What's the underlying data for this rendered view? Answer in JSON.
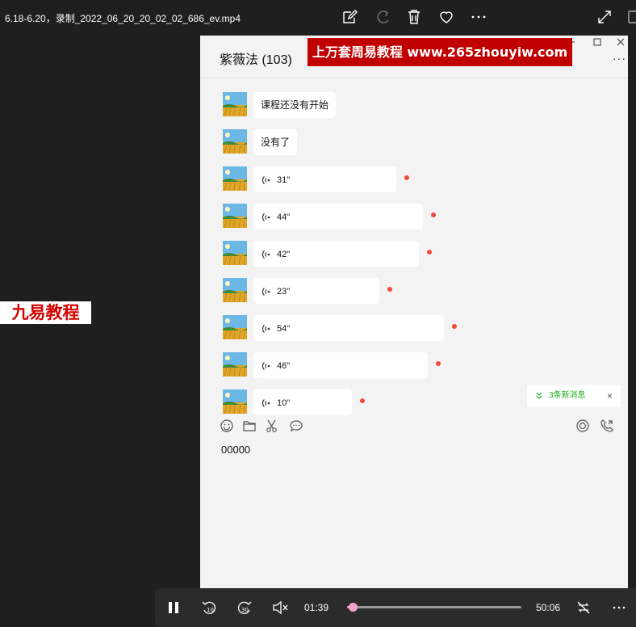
{
  "window": {
    "title": "6.18-6.20，录制_2022_06_20_20_02_02_686_ev.mp4"
  },
  "chat": {
    "title": "紫薇法 (103)",
    "banner": "上万套周易教程 www.265zhouyiw.com",
    "more": "···",
    "messages": [
      {
        "type": "text",
        "text": "课程还没有开始",
        "unread": false
      },
      {
        "type": "text",
        "text": "没有了",
        "unread": false
      },
      {
        "type": "voice",
        "text": "31\"",
        "seconds": 31,
        "unread": true
      },
      {
        "type": "voice",
        "text": "44\"",
        "seconds": 44,
        "unread": true
      },
      {
        "type": "voice",
        "text": "42\"",
        "seconds": 42,
        "unread": true
      },
      {
        "type": "voice",
        "text": "23\"",
        "seconds": 23,
        "unread": true
      },
      {
        "type": "voice",
        "text": "54\"",
        "seconds": 54,
        "unread": true
      },
      {
        "type": "voice",
        "text": "46\"",
        "seconds": 46,
        "unread": true
      },
      {
        "type": "voice",
        "text": "10\"",
        "seconds": 10,
        "unread": true
      }
    ],
    "new_messages": {
      "label": "3条新消息",
      "close": "×"
    },
    "input_text": "00000"
  },
  "watermark": "九易教程",
  "player": {
    "current_time": "01:39",
    "total_time": "50:06",
    "progress": 0.033
  },
  "colors": {
    "accent_pink": "#f6a2d1",
    "unread_dot": "#f04a3e",
    "banner_red": "#c00000",
    "green": "#1aad19"
  }
}
